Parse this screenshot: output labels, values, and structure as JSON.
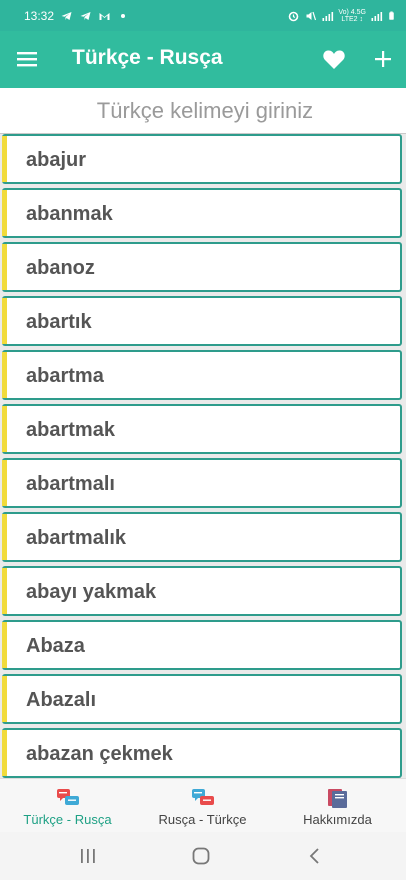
{
  "status_bar": {
    "time": "13:32",
    "network_top": "Vo) 4.5G",
    "network_bottom": "LTE2 ↕"
  },
  "app_bar": {
    "title": "Türkçe - Rusça",
    "menu_icon": "hamburger-menu-icon",
    "favorite_icon": "heart-icon",
    "add_icon": "plus-icon"
  },
  "search": {
    "placeholder": "Türkçe kelimeyi giriniz",
    "value": ""
  },
  "colors": {
    "accent_green": "#31bc9e",
    "item_border": "#2e9c8c",
    "item_stripe": "#f1db3b"
  },
  "words": [
    "abajur",
    "abanmak",
    "abanoz",
    "abartık",
    "abartma",
    "abartmak",
    "abartmalı",
    "abartmalık",
    "abayı yakmak",
    "Abaza",
    "Abazalı",
    "abazan çekmek"
  ],
  "bottom_nav": {
    "tabs": [
      {
        "label": "Türkçe - Rusça",
        "icon": "dictionary-tr-ru-icon",
        "active": true
      },
      {
        "label": "Rusça - Türkçe",
        "icon": "dictionary-ru-tr-icon",
        "active": false
      },
      {
        "label": "Hakkımızda",
        "icon": "books-icon",
        "active": false
      }
    ]
  },
  "system_nav": {
    "recents_icon": "recents-icon",
    "home_icon": "home-icon",
    "back_icon": "back-icon"
  }
}
